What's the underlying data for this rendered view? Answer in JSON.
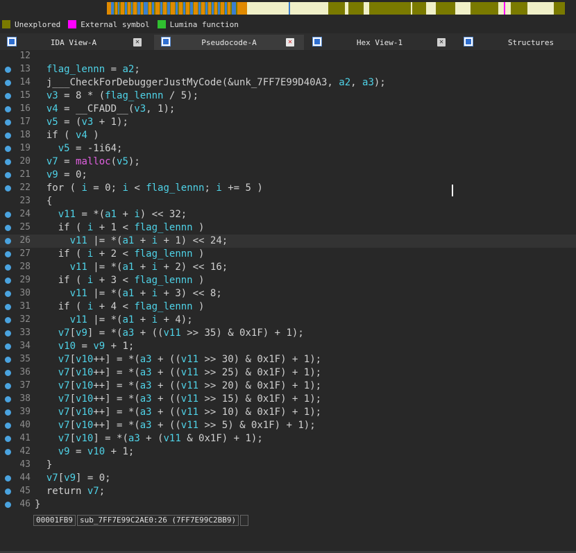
{
  "legend": [
    {
      "label": "Unexplored",
      "color": "#7a7a00"
    },
    {
      "label": "External symbol",
      "color": "#ff00ff"
    },
    {
      "label": "Lumina function",
      "color": "#30c030"
    }
  ],
  "tabs": [
    {
      "label": "IDA View-A",
      "active": false,
      "close": true
    },
    {
      "label": "Pseudocode-A",
      "active": true,
      "close": true
    },
    {
      "label": "Hex View-1",
      "active": false,
      "close": true
    },
    {
      "label": "Structures",
      "active": false,
      "close": false
    }
  ],
  "code": [
    {
      "n": "12",
      "bp": false,
      "tokens": []
    },
    {
      "n": "13",
      "bp": true,
      "tokens": [
        [
          "  ",
          ""
        ],
        [
          "flag_lennn",
          "v"
        ],
        [
          " = ",
          ""
        ],
        [
          "a2",
          "v"
        ],
        [
          ";",
          ""
        ]
      ]
    },
    {
      "n": "14",
      "bp": true,
      "tokens": [
        [
          "  j___CheckForDebuggerJustMyCode(&unk_7FF7E99D40A3, ",
          ""
        ],
        [
          "a2",
          "v"
        ],
        [
          ", ",
          ""
        ],
        [
          "a3",
          "v"
        ],
        [
          ");",
          ""
        ]
      ]
    },
    {
      "n": "15",
      "bp": true,
      "tokens": [
        [
          "  ",
          ""
        ],
        [
          "v3",
          "v"
        ],
        [
          " = 8 * (",
          ""
        ],
        [
          "flag_lennn",
          "v"
        ],
        [
          " / 5);",
          ""
        ]
      ]
    },
    {
      "n": "16",
      "bp": true,
      "tokens": [
        [
          "  ",
          ""
        ],
        [
          "v4",
          "v"
        ],
        [
          " = __CFADD__(",
          ""
        ],
        [
          "v3",
          "v"
        ],
        [
          ", 1);",
          ""
        ]
      ]
    },
    {
      "n": "17",
      "bp": true,
      "tokens": [
        [
          "  ",
          ""
        ],
        [
          "v5",
          "v"
        ],
        [
          " = (",
          ""
        ],
        [
          "v3",
          "v"
        ],
        [
          " + 1);",
          ""
        ]
      ]
    },
    {
      "n": "18",
      "bp": true,
      "tokens": [
        [
          "  if ( ",
          ""
        ],
        [
          "v4",
          "v"
        ],
        [
          " )",
          ""
        ]
      ]
    },
    {
      "n": "19",
      "bp": true,
      "tokens": [
        [
          "    ",
          ""
        ],
        [
          "v5",
          "v"
        ],
        [
          " = -1i64;",
          ""
        ]
      ]
    },
    {
      "n": "20",
      "bp": true,
      "tokens": [
        [
          "  ",
          ""
        ],
        [
          "v7",
          "v"
        ],
        [
          " = ",
          ""
        ],
        [
          "malloc",
          "f"
        ],
        [
          "(",
          ""
        ],
        [
          "v5",
          "v"
        ],
        [
          ");",
          ""
        ]
      ]
    },
    {
      "n": "21",
      "bp": true,
      "tokens": [
        [
          "  ",
          ""
        ],
        [
          "v9",
          "v"
        ],
        [
          " = 0;",
          ""
        ]
      ]
    },
    {
      "n": "22",
      "bp": true,
      "tokens": [
        [
          "  for ( ",
          ""
        ],
        [
          "i",
          "v"
        ],
        [
          " = 0; ",
          ""
        ],
        [
          "i",
          "v"
        ],
        [
          " < ",
          ""
        ],
        [
          "flag_lennn",
          "v"
        ],
        [
          "; ",
          ""
        ],
        [
          "i",
          "v"
        ],
        [
          " += 5 )",
          ""
        ]
      ]
    },
    {
      "n": "23",
      "bp": false,
      "tokens": [
        [
          "  {",
          ""
        ]
      ]
    },
    {
      "n": "24",
      "bp": true,
      "tokens": [
        [
          "    ",
          ""
        ],
        [
          "v11",
          "v"
        ],
        [
          " = *(",
          ""
        ],
        [
          "a1",
          "v"
        ],
        [
          " + ",
          ""
        ],
        [
          "i",
          "v"
        ],
        [
          ") << 32;",
          ""
        ]
      ]
    },
    {
      "n": "25",
      "bp": true,
      "tokens": [
        [
          "    if ( ",
          ""
        ],
        [
          "i",
          "v"
        ],
        [
          " + 1 < ",
          ""
        ],
        [
          "flag_lennn",
          "v"
        ],
        [
          " )",
          ""
        ]
      ]
    },
    {
      "n": "26",
      "bp": true,
      "cur": true,
      "tokens": [
        [
          "      ",
          ""
        ],
        [
          "v11",
          "v"
        ],
        [
          " |= *(",
          ""
        ],
        [
          "a1",
          "v"
        ],
        [
          " + ",
          ""
        ],
        [
          "i",
          "v"
        ],
        [
          " + 1) << 24;",
          ""
        ]
      ]
    },
    {
      "n": "27",
      "bp": true,
      "tokens": [
        [
          "    if ( ",
          ""
        ],
        [
          "i",
          "v"
        ],
        [
          " + 2 < ",
          ""
        ],
        [
          "flag_lennn",
          "v"
        ],
        [
          " )",
          ""
        ]
      ]
    },
    {
      "n": "28",
      "bp": true,
      "tokens": [
        [
          "      ",
          ""
        ],
        [
          "v11",
          "v"
        ],
        [
          " |= *(",
          ""
        ],
        [
          "a1",
          "v"
        ],
        [
          " + ",
          ""
        ],
        [
          "i",
          "v"
        ],
        [
          " + 2) << 16;",
          ""
        ]
      ]
    },
    {
      "n": "29",
      "bp": true,
      "tokens": [
        [
          "    if ( ",
          ""
        ],
        [
          "i",
          "v"
        ],
        [
          " + 3 < ",
          ""
        ],
        [
          "flag_lennn",
          "v"
        ],
        [
          " )",
          ""
        ]
      ]
    },
    {
      "n": "30",
      "bp": true,
      "tokens": [
        [
          "      ",
          ""
        ],
        [
          "v11",
          "v"
        ],
        [
          " |= *(",
          ""
        ],
        [
          "a1",
          "v"
        ],
        [
          " + ",
          ""
        ],
        [
          "i",
          "v"
        ],
        [
          " + 3) << 8;",
          ""
        ]
      ]
    },
    {
      "n": "31",
      "bp": true,
      "tokens": [
        [
          "    if ( ",
          ""
        ],
        [
          "i",
          "v"
        ],
        [
          " + 4 < ",
          ""
        ],
        [
          "flag_lennn",
          "v"
        ],
        [
          " )",
          ""
        ]
      ]
    },
    {
      "n": "32",
      "bp": true,
      "tokens": [
        [
          "      ",
          ""
        ],
        [
          "v11",
          "v"
        ],
        [
          " |= *(",
          ""
        ],
        [
          "a1",
          "v"
        ],
        [
          " + ",
          ""
        ],
        [
          "i",
          "v"
        ],
        [
          " + 4);",
          ""
        ]
      ]
    },
    {
      "n": "33",
      "bp": true,
      "tokens": [
        [
          "    ",
          ""
        ],
        [
          "v7",
          "v"
        ],
        [
          "[",
          ""
        ],
        [
          "v9",
          "v"
        ],
        [
          "] = *(",
          ""
        ],
        [
          "a3",
          "v"
        ],
        [
          " + ((",
          ""
        ],
        [
          "v11",
          "v"
        ],
        [
          " >> 35) & 0x1F) + 1);",
          ""
        ]
      ]
    },
    {
      "n": "34",
      "bp": true,
      "tokens": [
        [
          "    ",
          ""
        ],
        [
          "v10",
          "v"
        ],
        [
          " = ",
          ""
        ],
        [
          "v9",
          "v"
        ],
        [
          " + 1;",
          ""
        ]
      ]
    },
    {
      "n": "35",
      "bp": true,
      "tokens": [
        [
          "    ",
          ""
        ],
        [
          "v7",
          "v"
        ],
        [
          "[",
          ""
        ],
        [
          "v10",
          "v"
        ],
        [
          "++] = *(",
          ""
        ],
        [
          "a3",
          "v"
        ],
        [
          " + ((",
          ""
        ],
        [
          "v11",
          "v"
        ],
        [
          " >> 30) & 0x1F) + 1);",
          ""
        ]
      ]
    },
    {
      "n": "36",
      "bp": true,
      "tokens": [
        [
          "    ",
          ""
        ],
        [
          "v7",
          "v"
        ],
        [
          "[",
          ""
        ],
        [
          "v10",
          "v"
        ],
        [
          "++] = *(",
          ""
        ],
        [
          "a3",
          "v"
        ],
        [
          " + ((",
          ""
        ],
        [
          "v11",
          "v"
        ],
        [
          " >> 25) & 0x1F) + 1);",
          ""
        ]
      ]
    },
    {
      "n": "37",
      "bp": true,
      "tokens": [
        [
          "    ",
          ""
        ],
        [
          "v7",
          "v"
        ],
        [
          "[",
          ""
        ],
        [
          "v10",
          "v"
        ],
        [
          "++] = *(",
          ""
        ],
        [
          "a3",
          "v"
        ],
        [
          " + ((",
          ""
        ],
        [
          "v11",
          "v"
        ],
        [
          " >> 20) & 0x1F) + 1);",
          ""
        ]
      ]
    },
    {
      "n": "38",
      "bp": true,
      "tokens": [
        [
          "    ",
          ""
        ],
        [
          "v7",
          "v"
        ],
        [
          "[",
          ""
        ],
        [
          "v10",
          "v"
        ],
        [
          "++] = *(",
          ""
        ],
        [
          "a3",
          "v"
        ],
        [
          " + ((",
          ""
        ],
        [
          "v11",
          "v"
        ],
        [
          " >> 15) & 0x1F) + 1);",
          ""
        ]
      ]
    },
    {
      "n": "39",
      "bp": true,
      "tokens": [
        [
          "    ",
          ""
        ],
        [
          "v7",
          "v"
        ],
        [
          "[",
          ""
        ],
        [
          "v10",
          "v"
        ],
        [
          "++] = *(",
          ""
        ],
        [
          "a3",
          "v"
        ],
        [
          " + ((",
          ""
        ],
        [
          "v11",
          "v"
        ],
        [
          " >> 10) & 0x1F) + 1);",
          ""
        ]
      ]
    },
    {
      "n": "40",
      "bp": true,
      "tokens": [
        [
          "    ",
          ""
        ],
        [
          "v7",
          "v"
        ],
        [
          "[",
          ""
        ],
        [
          "v10",
          "v"
        ],
        [
          "++] = *(",
          ""
        ],
        [
          "a3",
          "v"
        ],
        [
          " + ((",
          ""
        ],
        [
          "v11",
          "v"
        ],
        [
          " >> 5) & 0x1F) + 1);",
          ""
        ]
      ]
    },
    {
      "n": "41",
      "bp": true,
      "tokens": [
        [
          "    ",
          ""
        ],
        [
          "v7",
          "v"
        ],
        [
          "[",
          ""
        ],
        [
          "v10",
          "v"
        ],
        [
          "] = *(",
          ""
        ],
        [
          "a3",
          "v"
        ],
        [
          " + (",
          ""
        ],
        [
          "v11",
          "v"
        ],
        [
          " & 0x1F) + 1);",
          ""
        ]
      ]
    },
    {
      "n": "42",
      "bp": true,
      "tokens": [
        [
          "    ",
          ""
        ],
        [
          "v9",
          "v"
        ],
        [
          " = ",
          ""
        ],
        [
          "v10",
          "v"
        ],
        [
          " + 1;",
          ""
        ]
      ]
    },
    {
      "n": "43",
      "bp": false,
      "tokens": [
        [
          "  }",
          ""
        ]
      ]
    },
    {
      "n": "44",
      "bp": true,
      "tokens": [
        [
          "  ",
          ""
        ],
        [
          "v7",
          "v"
        ],
        [
          "[",
          ""
        ],
        [
          "v9",
          "v"
        ],
        [
          "] = 0;",
          ""
        ]
      ]
    },
    {
      "n": "45",
      "bp": true,
      "tokens": [
        [
          "  return ",
          ""
        ],
        [
          "v7",
          "v"
        ],
        [
          ";",
          ""
        ]
      ]
    },
    {
      "n": "46",
      "bp": true,
      "tokens": [
        [
          "}",
          ""
        ]
      ]
    }
  ],
  "status": {
    "offset": "00001FB9",
    "location": "sub_7FF7E99C2AE0:26 (7FF7E99C2BB9)"
  }
}
